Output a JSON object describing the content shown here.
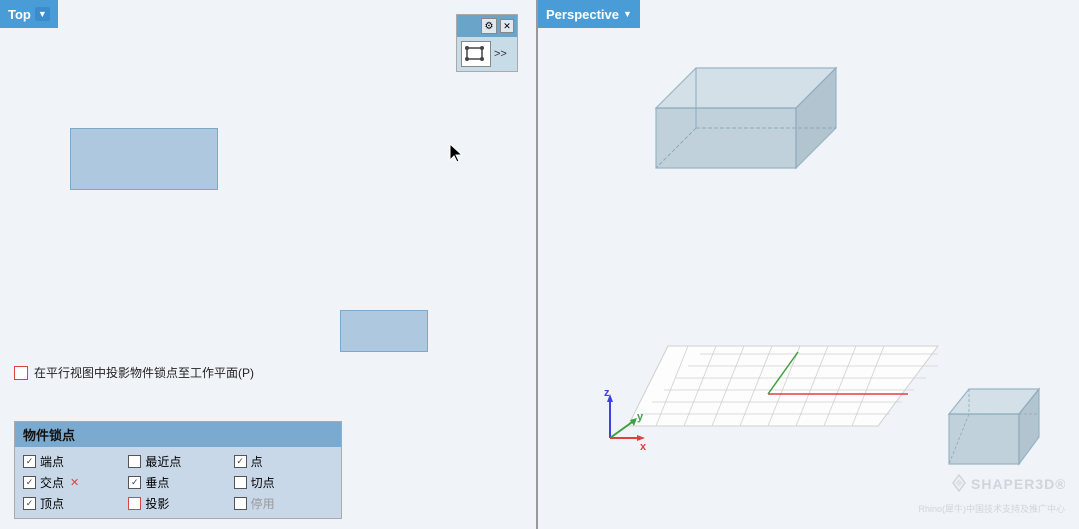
{
  "left_viewport": {
    "title": "Top",
    "dropdown_arrow": "▼"
  },
  "right_viewport": {
    "title": "Perspective",
    "dropdown_arrow": "▼"
  },
  "toolbar": {
    "gear_icon": "⚙",
    "close_icon": "✕",
    "expand_icon": ">>"
  },
  "snap_checkbox_label": "在平行视图中投影物件锁点至工作平面(P)",
  "osnap_panel": {
    "title": "物件锁点",
    "items": [
      {
        "label": "端点",
        "checked": true,
        "col": 1
      },
      {
        "label": "最近点",
        "checked": false,
        "col": 2
      },
      {
        "label": "点",
        "checked": true,
        "col": 3
      },
      {
        "label": "交点",
        "checked": true,
        "col": 1,
        "has_x": true
      },
      {
        "label": "垂点",
        "checked": true,
        "col": 2
      },
      {
        "label": "切点",
        "checked": false,
        "col": 3
      },
      {
        "label": "顶点",
        "checked": true,
        "col": 1
      },
      {
        "label": "投影",
        "checked": false,
        "col": 2,
        "red_border": true
      },
      {
        "label": "停用",
        "checked": false,
        "col": 3,
        "disabled": true
      }
    ]
  },
  "watermark": {
    "brand": "SHAPER3D®",
    "sub": "Rhino(犀牛)中国技术支持及推广中心"
  },
  "colors": {
    "header_bg": "#4a9cd6",
    "box_fill": "#b8ccd8",
    "box_stroke": "#8aaabb",
    "grid_line": "#ccc",
    "axis_x": "#e04040",
    "axis_y": "#40c040",
    "axis_z": "#4040e0"
  }
}
